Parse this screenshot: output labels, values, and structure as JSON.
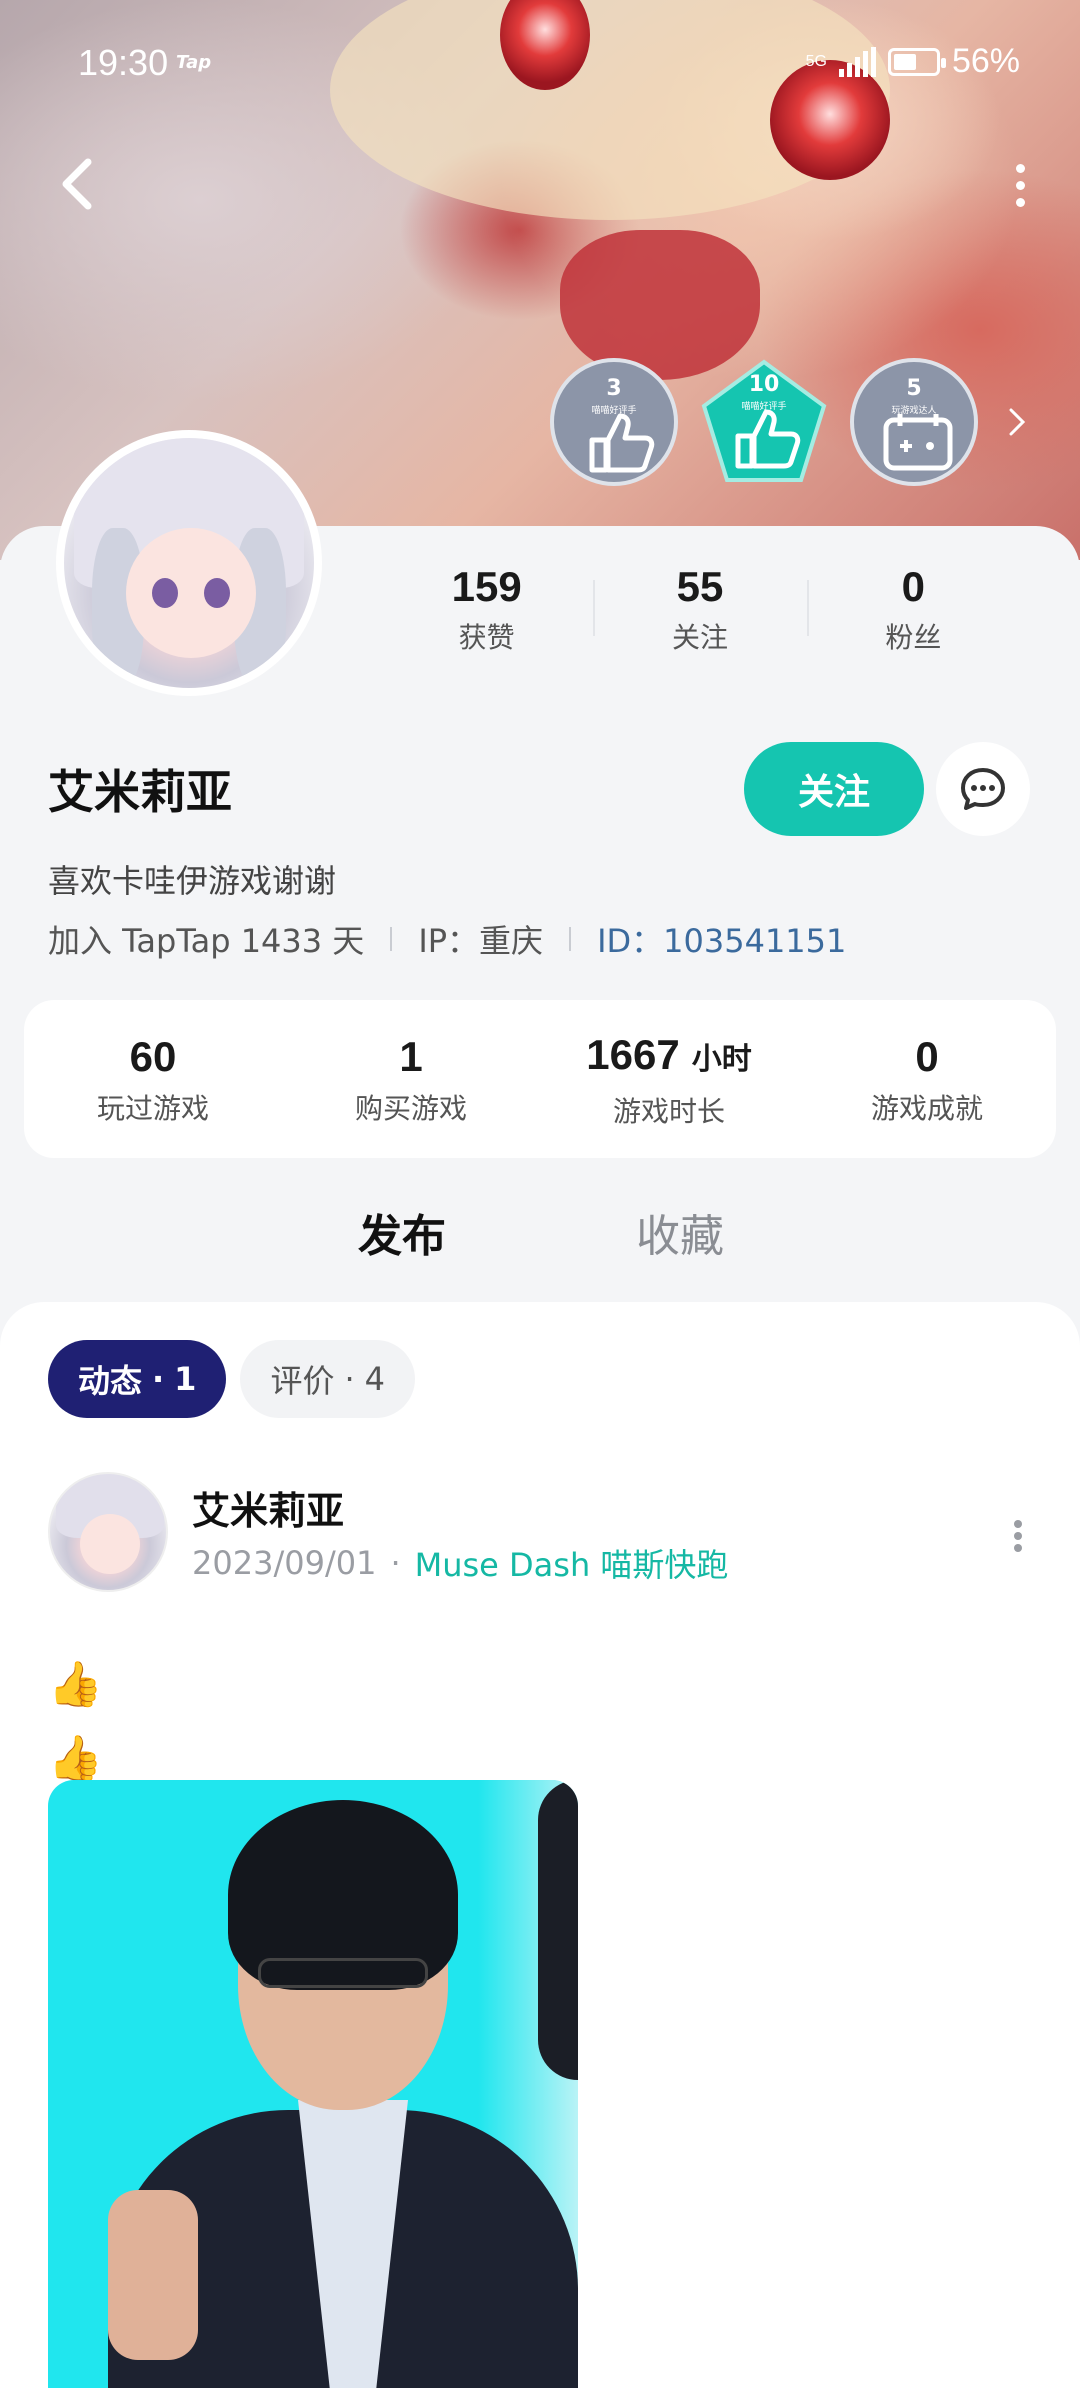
{
  "status_bar": {
    "time": "19:30",
    "app_tag": "Tap",
    "network": "5G",
    "battery": "56%",
    "battery_level": 0.56
  },
  "badges": [
    {
      "number": "3",
      "label": "喵喵好评手",
      "color": "#8c95a8",
      "icon": "thumbs-up-icon"
    },
    {
      "number": "10",
      "label": "喵喵好评手",
      "color": "#15c5b0",
      "icon": "thumbs-up-icon"
    },
    {
      "number": "5",
      "label": "玩游戏达人",
      "color": "#8c95a8",
      "icon": "gamepad-calendar-icon"
    }
  ],
  "profile": {
    "stats": [
      {
        "value": "159",
        "label": "获赞"
      },
      {
        "value": "55",
        "label": "关注"
      },
      {
        "value": "0",
        "label": "粉丝"
      }
    ],
    "name": "艾米莉亚",
    "follow_label": "关注",
    "bio": "喜欢卡哇伊游戏谢谢",
    "joined": "加入 TapTap 1433 天",
    "ip": "IP：重庆",
    "id": "ID：103541151"
  },
  "game_stats": [
    {
      "value": "60",
      "unit": "",
      "label": "玩过游戏"
    },
    {
      "value": "1",
      "unit": "",
      "label": "购买游戏"
    },
    {
      "value": "1667",
      "unit": "小时",
      "label": "游戏时长"
    },
    {
      "value": "0",
      "unit": "",
      "label": "游戏成就"
    }
  ],
  "tabs": {
    "active": "发布",
    "inactive": "收藏"
  },
  "chips": [
    {
      "label": "动态",
      "count": "1"
    },
    {
      "label": "评价",
      "count": "4"
    }
  ],
  "post": {
    "author": "艾米莉亚",
    "date": "2023/09/01",
    "game": "Muse Dash 喵斯快跑",
    "lines": [
      "👍",
      "👍"
    ]
  },
  "colors": {
    "accent": "#15c5b0",
    "chip_active": "#1f2073",
    "id_link": "#3b6a9d"
  }
}
